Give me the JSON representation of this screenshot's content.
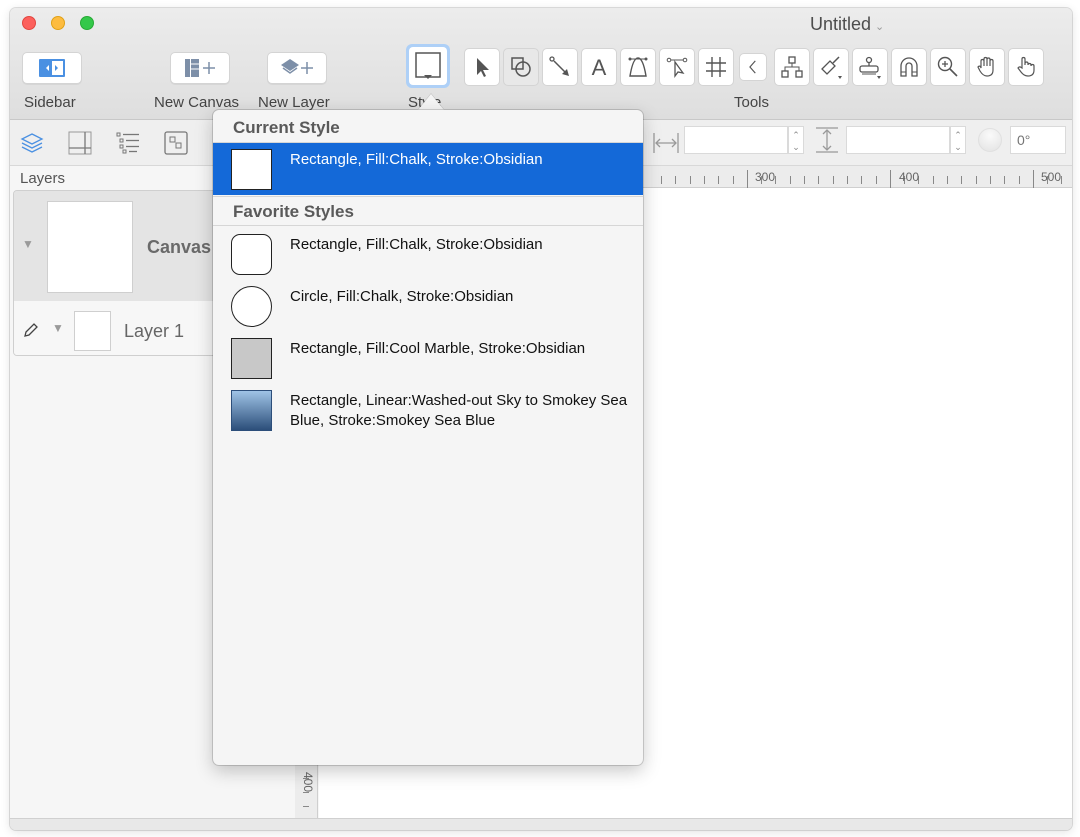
{
  "window": {
    "title": "Untitled",
    "title_menu_icon": "chevron-down-icon"
  },
  "toolbar": {
    "sidebar_label": "Sidebar",
    "new_canvas_label": "New Canvas",
    "new_layer_label": "New Layer",
    "style_label": "Style",
    "tools_label": "Tools",
    "tools": [
      {
        "name": "selection-tool",
        "icon": "arrow-pointer-icon"
      },
      {
        "name": "shape-tool",
        "icon": "shapes-icon"
      },
      {
        "name": "line-tool",
        "icon": "line-arrow-icon"
      },
      {
        "name": "text-tool",
        "icon": "text-icon"
      },
      {
        "name": "pen-tool",
        "icon": "bezier-icon"
      },
      {
        "name": "point-editor-tool",
        "icon": "point-editor-icon"
      },
      {
        "name": "table-tool",
        "icon": "hash-grid-icon"
      },
      {
        "name": "collapse-tools",
        "icon": "chevron-left-icon"
      },
      {
        "name": "diagram-tool",
        "icon": "hierarchy-icon"
      },
      {
        "name": "style-brush-tool",
        "icon": "brush-icon"
      },
      {
        "name": "rubber-stamp-tool",
        "icon": "stamp-icon"
      },
      {
        "name": "magnet-tool",
        "icon": "magnet-icon"
      },
      {
        "name": "zoom-tool",
        "icon": "zoom-in-icon"
      },
      {
        "name": "hand-tool",
        "icon": "hand-icon"
      },
      {
        "name": "browse-tool",
        "icon": "pointing-hand-icon"
      }
    ]
  },
  "inspector_bar": {
    "width_value": "",
    "height_value": "",
    "rotation_placeholder": "0°"
  },
  "sidebar": {
    "section_label": "Layers",
    "canvas_name": "Canvas",
    "layer_name": "Layer 1"
  },
  "rulers": {
    "top_labels": [
      "300",
      "400",
      "500"
    ],
    "left_labels": [
      "400"
    ]
  },
  "style_popover": {
    "current_heading": "Current Style",
    "current": {
      "label": "Rectangle, Fill:Chalk, Stroke:Obsidian",
      "shape": "rectangle"
    },
    "favorites_heading": "Favorite Styles",
    "favorites": [
      {
        "label": "Rectangle, Fill:Chalk, Stroke:Obsidian",
        "shape": "rounded-rectangle"
      },
      {
        "label": "Circle, Fill:Chalk, Stroke:Obsidian",
        "shape": "circle"
      },
      {
        "label": "Rectangle, Fill:Cool Marble, Stroke:Obsidian",
        "shape": "rectangle-gray"
      },
      {
        "label": "Rectangle, Linear:Washed-out Sky to Smokey Sea Blue, Stroke:Smokey Sea Blue",
        "shape": "rectangle-gradient"
      }
    ]
  },
  "colors": {
    "selection": "#1469d8",
    "accent_blue": "#4a90e2",
    "cool_marble": "#c8c8c8",
    "washed_out_sky": "#8fb4dc",
    "smokey_sea_blue": "#2c4e7a"
  }
}
